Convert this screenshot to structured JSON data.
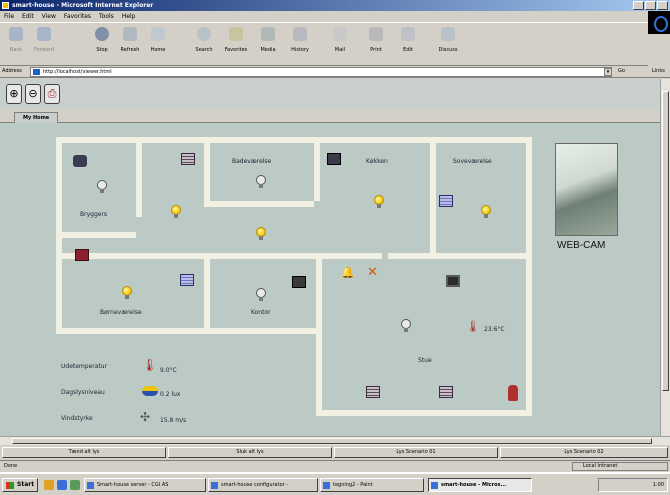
{
  "window": {
    "title": "smart-house - Microsoft Internet Explorer"
  },
  "menu": [
    "File",
    "Edit",
    "View",
    "Favorites",
    "Tools",
    "Help"
  ],
  "toolbar": [
    {
      "label": "Back",
      "icon": "back-arrow-icon",
      "dim": true
    },
    {
      "label": "Forward",
      "icon": "forward-arrow-icon",
      "dim": true
    },
    {
      "label": "Stop",
      "icon": "stop-icon"
    },
    {
      "label": "Refresh",
      "icon": "refresh-icon"
    },
    {
      "label": "Home",
      "icon": "home-icon"
    },
    {
      "label": "Search",
      "icon": "search-icon"
    },
    {
      "label": "Favorites",
      "icon": "favorites-icon"
    },
    {
      "label": "Media",
      "icon": "media-icon"
    },
    {
      "label": "History",
      "icon": "history-icon"
    },
    {
      "label": "Mail",
      "icon": "mail-icon"
    },
    {
      "label": "Print",
      "icon": "print-icon"
    },
    {
      "label": "Edit",
      "icon": "edit-icon"
    },
    {
      "label": "Discuss",
      "icon": "discuss-icon"
    }
  ],
  "address": {
    "label": "Address",
    "value": "http://localhost/viewer.html",
    "go": "Go",
    "links": "Links"
  },
  "app": {
    "tab": "My Home",
    "rooms": {
      "bryggers": "Bryggers",
      "badevaerelse": "Badeværelse",
      "koekken": "Køkken",
      "sovevaerelse": "Soveværelse",
      "boernevaerelse": "Børneværelse",
      "kontor": "Kontor",
      "stue": "Stue"
    },
    "stue_temp": "23.6°C",
    "weather": {
      "outdoor_label": "Udetemperatur",
      "outdoor_value": "9.0°C",
      "daylight_label": "Dagslysniveau",
      "daylight_value": "0.2 lux",
      "wind_label": "Vindstyrke",
      "wind_value": "15.8 m/s"
    },
    "webcam_label": "WEB-CAM",
    "scenes": [
      "Tænd alt lys",
      "Sluk alt lys",
      "Lys Scenario 01",
      "Lys Scenario 02"
    ]
  },
  "status": {
    "text": "Done",
    "zone": "Local intranet"
  },
  "taskbar": {
    "start": "Start",
    "tasks": [
      "Smart-house server - CGI AS",
      "smart-house configurator -",
      "tegning2 - Paint",
      "smart-house - Micros..."
    ],
    "clock": "1:00"
  },
  "colors": {
    "canvas": "#bccac5",
    "wall": "#f1f0e2",
    "titlebar": "#0a246a"
  }
}
